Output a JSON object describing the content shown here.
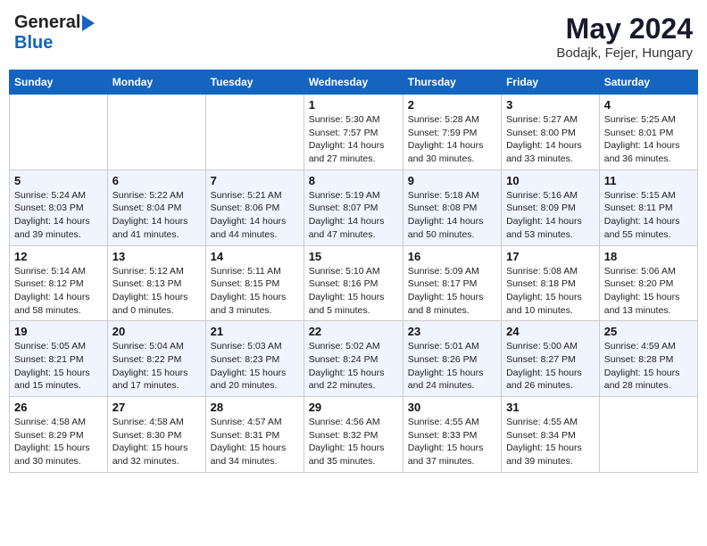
{
  "header": {
    "logo_general": "General",
    "logo_blue": "Blue",
    "month_title": "May 2024",
    "location": "Bodajk, Fejer, Hungary"
  },
  "weekdays": [
    "Sunday",
    "Monday",
    "Tuesday",
    "Wednesday",
    "Thursday",
    "Friday",
    "Saturday"
  ],
  "weeks": [
    [
      {
        "day": "",
        "info": ""
      },
      {
        "day": "",
        "info": ""
      },
      {
        "day": "",
        "info": ""
      },
      {
        "day": "1",
        "info": "Sunrise: 5:30 AM\nSunset: 7:57 PM\nDaylight: 14 hours\nand 27 minutes."
      },
      {
        "day": "2",
        "info": "Sunrise: 5:28 AM\nSunset: 7:59 PM\nDaylight: 14 hours\nand 30 minutes."
      },
      {
        "day": "3",
        "info": "Sunrise: 5:27 AM\nSunset: 8:00 PM\nDaylight: 14 hours\nand 33 minutes."
      },
      {
        "day": "4",
        "info": "Sunrise: 5:25 AM\nSunset: 8:01 PM\nDaylight: 14 hours\nand 36 minutes."
      }
    ],
    [
      {
        "day": "5",
        "info": "Sunrise: 5:24 AM\nSunset: 8:03 PM\nDaylight: 14 hours\nand 39 minutes."
      },
      {
        "day": "6",
        "info": "Sunrise: 5:22 AM\nSunset: 8:04 PM\nDaylight: 14 hours\nand 41 minutes."
      },
      {
        "day": "7",
        "info": "Sunrise: 5:21 AM\nSunset: 8:06 PM\nDaylight: 14 hours\nand 44 minutes."
      },
      {
        "day": "8",
        "info": "Sunrise: 5:19 AM\nSunset: 8:07 PM\nDaylight: 14 hours\nand 47 minutes."
      },
      {
        "day": "9",
        "info": "Sunrise: 5:18 AM\nSunset: 8:08 PM\nDaylight: 14 hours\nand 50 minutes."
      },
      {
        "day": "10",
        "info": "Sunrise: 5:16 AM\nSunset: 8:09 PM\nDaylight: 14 hours\nand 53 minutes."
      },
      {
        "day": "11",
        "info": "Sunrise: 5:15 AM\nSunset: 8:11 PM\nDaylight: 14 hours\nand 55 minutes."
      }
    ],
    [
      {
        "day": "12",
        "info": "Sunrise: 5:14 AM\nSunset: 8:12 PM\nDaylight: 14 hours\nand 58 minutes."
      },
      {
        "day": "13",
        "info": "Sunrise: 5:12 AM\nSunset: 8:13 PM\nDaylight: 15 hours\nand 0 minutes."
      },
      {
        "day": "14",
        "info": "Sunrise: 5:11 AM\nSunset: 8:15 PM\nDaylight: 15 hours\nand 3 minutes."
      },
      {
        "day": "15",
        "info": "Sunrise: 5:10 AM\nSunset: 8:16 PM\nDaylight: 15 hours\nand 5 minutes."
      },
      {
        "day": "16",
        "info": "Sunrise: 5:09 AM\nSunset: 8:17 PM\nDaylight: 15 hours\nand 8 minutes."
      },
      {
        "day": "17",
        "info": "Sunrise: 5:08 AM\nSunset: 8:18 PM\nDaylight: 15 hours\nand 10 minutes."
      },
      {
        "day": "18",
        "info": "Sunrise: 5:06 AM\nSunset: 8:20 PM\nDaylight: 15 hours\nand 13 minutes."
      }
    ],
    [
      {
        "day": "19",
        "info": "Sunrise: 5:05 AM\nSunset: 8:21 PM\nDaylight: 15 hours\nand 15 minutes."
      },
      {
        "day": "20",
        "info": "Sunrise: 5:04 AM\nSunset: 8:22 PM\nDaylight: 15 hours\nand 17 minutes."
      },
      {
        "day": "21",
        "info": "Sunrise: 5:03 AM\nSunset: 8:23 PM\nDaylight: 15 hours\nand 20 minutes."
      },
      {
        "day": "22",
        "info": "Sunrise: 5:02 AM\nSunset: 8:24 PM\nDaylight: 15 hours\nand 22 minutes."
      },
      {
        "day": "23",
        "info": "Sunrise: 5:01 AM\nSunset: 8:26 PM\nDaylight: 15 hours\nand 24 minutes."
      },
      {
        "day": "24",
        "info": "Sunrise: 5:00 AM\nSunset: 8:27 PM\nDaylight: 15 hours\nand 26 minutes."
      },
      {
        "day": "25",
        "info": "Sunrise: 4:59 AM\nSunset: 8:28 PM\nDaylight: 15 hours\nand 28 minutes."
      }
    ],
    [
      {
        "day": "26",
        "info": "Sunrise: 4:58 AM\nSunset: 8:29 PM\nDaylight: 15 hours\nand 30 minutes."
      },
      {
        "day": "27",
        "info": "Sunrise: 4:58 AM\nSunset: 8:30 PM\nDaylight: 15 hours\nand 32 minutes."
      },
      {
        "day": "28",
        "info": "Sunrise: 4:57 AM\nSunset: 8:31 PM\nDaylight: 15 hours\nand 34 minutes."
      },
      {
        "day": "29",
        "info": "Sunrise: 4:56 AM\nSunset: 8:32 PM\nDaylight: 15 hours\nand 35 minutes."
      },
      {
        "day": "30",
        "info": "Sunrise: 4:55 AM\nSunset: 8:33 PM\nDaylight: 15 hours\nand 37 minutes."
      },
      {
        "day": "31",
        "info": "Sunrise: 4:55 AM\nSunset: 8:34 PM\nDaylight: 15 hours\nand 39 minutes."
      },
      {
        "day": "",
        "info": ""
      }
    ]
  ]
}
